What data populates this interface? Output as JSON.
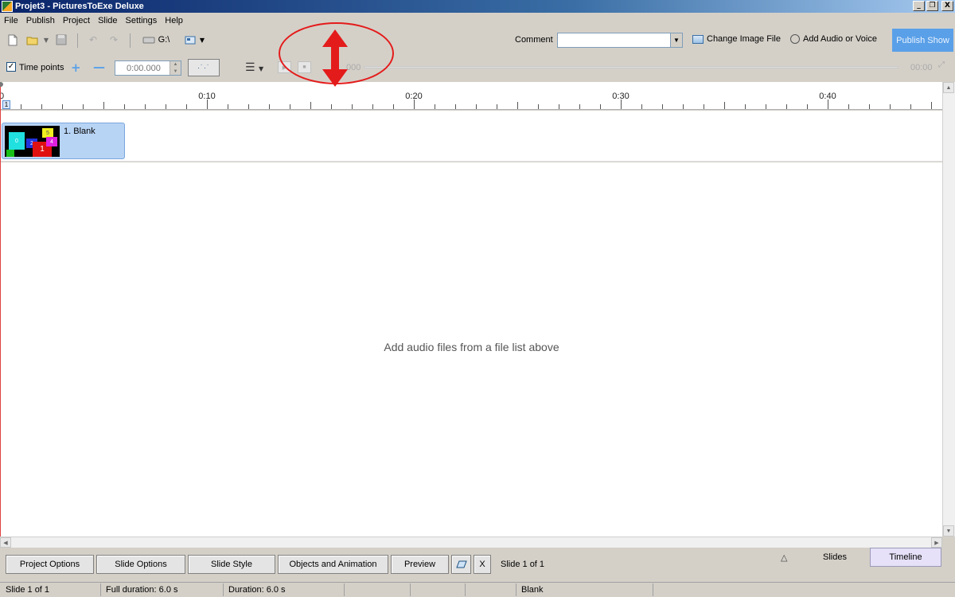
{
  "window": {
    "title": "Projet3 - PicturesToExe Deluxe",
    "minimize": "_",
    "restore": "❐",
    "close": "X"
  },
  "menu": [
    "File",
    "Publish",
    "Project",
    "Slide",
    "Settings",
    "Help"
  ],
  "toolbar": {
    "drive_label": "G:\\",
    "comment_label": "Comment",
    "comment_value": "",
    "change_image_label": "Change Image File",
    "add_audio_label": "Add Audio or Voice",
    "publish_label": "Publish Show"
  },
  "timeline_toolbar": {
    "time_points_label": "Time points",
    "time_points_checked": true,
    "time_value": "0:00.000",
    "play_time": "000",
    "end_time": "00:00"
  },
  "ruler": {
    "labels": [
      "0:10",
      "0:20",
      "0:30",
      "0:40"
    ],
    "start_label": "0",
    "marker": "1"
  },
  "slides": [
    {
      "name": "1. Blank"
    }
  ],
  "audio_hint": "Add audio files from a file list above",
  "bottom_buttons": {
    "project_options": "Project Options",
    "slide_options": "Slide Options",
    "slide_style": "Slide Style",
    "objects_animation": "Objects and Animation",
    "preview": "Preview",
    "x": "X",
    "slide_counter": "Slide 1 of 1"
  },
  "view_tabs": {
    "collapse": "△",
    "slides": "Slides",
    "timeline": "Timeline",
    "active": "Timeline"
  },
  "status": {
    "slide": "Slide 1 of 1",
    "full_duration": "Full duration: 6.0 s",
    "duration": "Duration: 6.0 s",
    "slide_name": "Blank"
  },
  "colors": {
    "accent": "#5aa0e8",
    "annotation": "#e41b1b",
    "selection": "#b8d4f5"
  }
}
